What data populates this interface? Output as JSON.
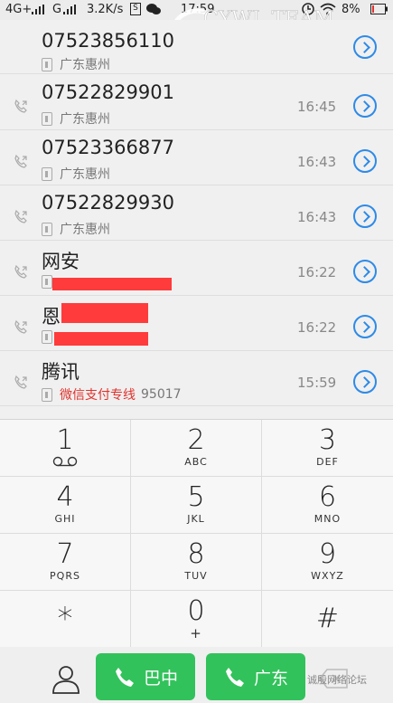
{
  "status_bar": {
    "network1": "4G+",
    "network2": "G",
    "speed": "3.2K/s",
    "time": "17:59",
    "battery": "8%"
  },
  "watermark": {
    "line1": "CYWL TEAM",
    "line2": "ChengYin.Org"
  },
  "calls": [
    {
      "name": "07523856110",
      "location": "广东惠州",
      "time": ""
    },
    {
      "name": "07522829901",
      "location": "广东惠州",
      "time": "16:45"
    },
    {
      "name": "07523366877",
      "location": "广东惠州",
      "time": "16:43"
    },
    {
      "name": "07522829930",
      "location": "广东惠州",
      "time": "16:43"
    },
    {
      "name": "网安",
      "location": "",
      "time": "16:22"
    },
    {
      "name": "恩",
      "location": "",
      "time": "16:22"
    },
    {
      "name": "腾讯",
      "tag": "微信支付专线",
      "location": "95017",
      "time": "15:59"
    }
  ],
  "keypad": [
    {
      "digit": "1",
      "letters": ""
    },
    {
      "digit": "2",
      "letters": "ABC"
    },
    {
      "digit": "3",
      "letters": "DEF"
    },
    {
      "digit": "4",
      "letters": "GHI"
    },
    {
      "digit": "5",
      "letters": "JKL"
    },
    {
      "digit": "6",
      "letters": "MNO"
    },
    {
      "digit": "7",
      "letters": "PQRS"
    },
    {
      "digit": "8",
      "letters": "TUV"
    },
    {
      "digit": "9",
      "letters": "WXYZ"
    },
    {
      "digit": "*",
      "letters": ""
    },
    {
      "digit": "0",
      "letters": "+"
    },
    {
      "digit": "#",
      "letters": ""
    }
  ],
  "bottom": {
    "call1_label": "巴中",
    "call2_label": "广东",
    "forum_text": "诚殷网络论坛"
  },
  "colors": {
    "accent_blue": "#2d8ae8",
    "call_green": "#32c25b",
    "redaction": "#ff3b3b"
  }
}
